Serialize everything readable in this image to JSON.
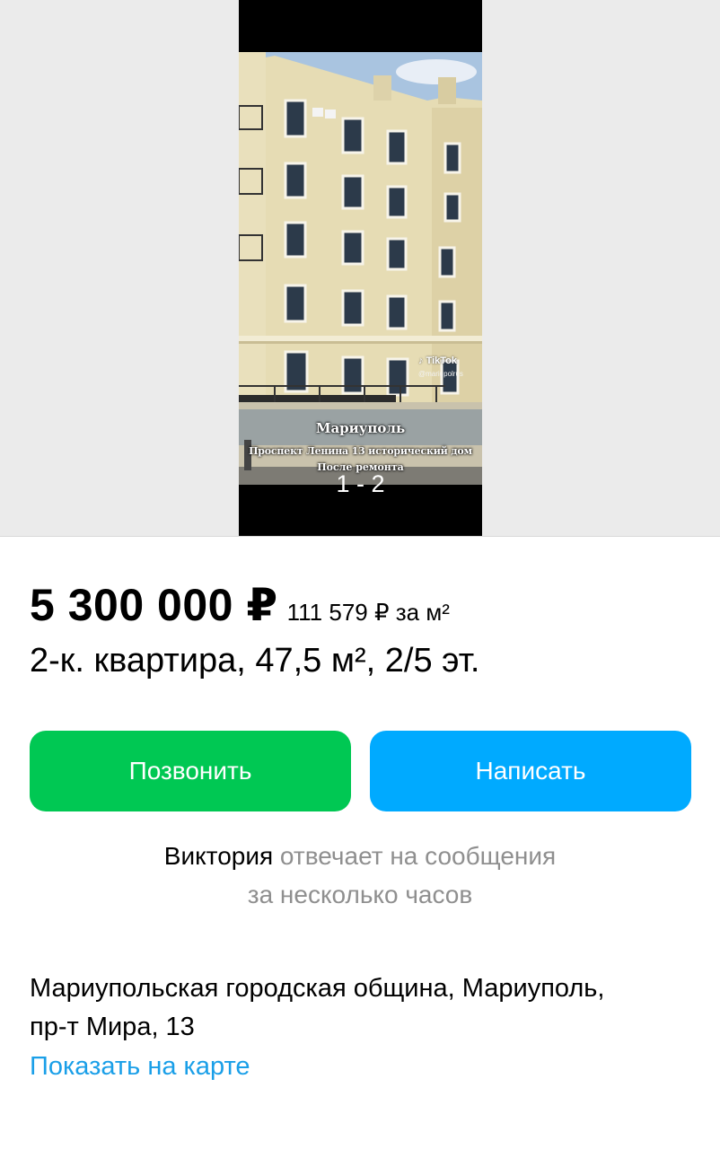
{
  "gallery": {
    "overlay": {
      "line1": "Мариуполь",
      "line2": "Проспект Ленина 13 исторический дом",
      "line3": "После ремонта"
    },
    "watermark": {
      "brand": "TikTok",
      "handle": "@mariupolrus"
    },
    "counter": "1 - 2"
  },
  "listing": {
    "price": "5 300 000 ₽",
    "price_per_m2": "111 579 ₽ за м²",
    "title": "2-к. квартира, 47,5 м², 2/5 эт."
  },
  "actions": {
    "call_label": "Позвонить",
    "write_label": "Написать"
  },
  "seller": {
    "name": "Виктория",
    "response_part1": "отвечает на сообщения",
    "response_part2": "за несколько часов"
  },
  "location": {
    "address_line1": "Мариупольская городская община, Мариуполь,",
    "address_line2": "пр-т Мира, 13",
    "map_link": "Показать на карте"
  },
  "colors": {
    "call_button": "#00c853",
    "write_button": "#00aaff",
    "link": "#1a9fe8",
    "gallery_background": "#ebebeb"
  }
}
